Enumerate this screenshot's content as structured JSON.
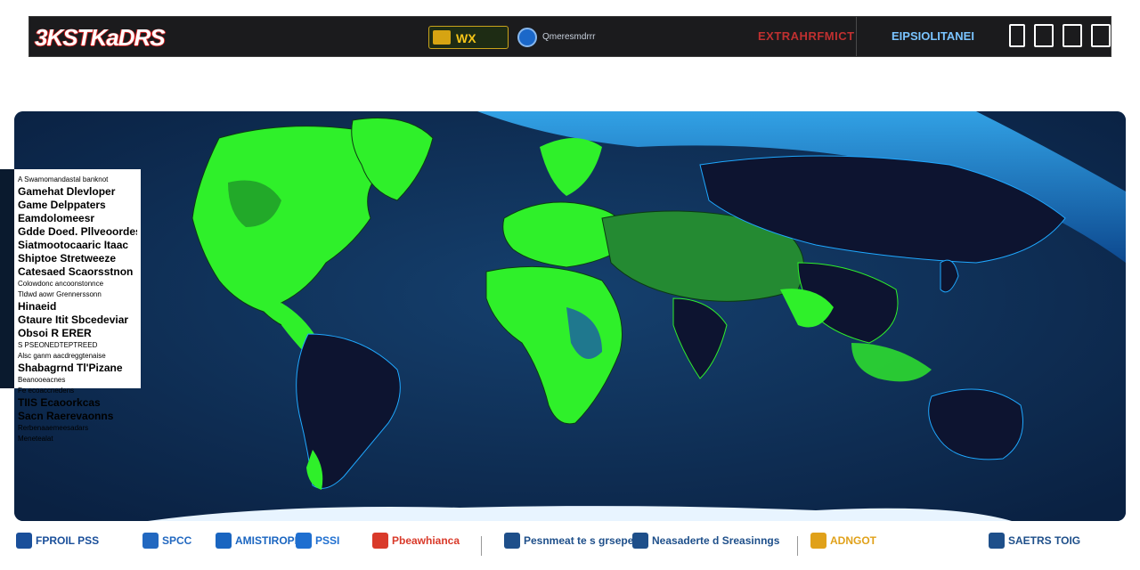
{
  "header": {
    "logo": "3KSTKaDRS",
    "badge1": "WX",
    "badge2": "Qmeresmdrrr",
    "center_text": "EXTRAHRFMICT",
    "right_text": "EIPSIOLITANEI"
  },
  "legend": {
    "rows": [
      {
        "text": "A Swamomandastal banknot",
        "style": "sm"
      },
      {
        "text": "Gamehat Dlevloper",
        "style": "b"
      },
      {
        "text": "Game Delppaters",
        "style": "b"
      },
      {
        "text": "Eamdolomeesr",
        "style": "b"
      },
      {
        "text": "Gdde Doed. Pllveoordes",
        "style": "b"
      },
      {
        "text": "Siatmootocaaric Itaac",
        "style": "b"
      },
      {
        "text": "Shiptoe Stretweeze",
        "style": "b"
      },
      {
        "text": "Catesaed Scaorsstnon",
        "style": "b"
      },
      {
        "text": "Colowdonc ancoonstonnce",
        "style": "sm"
      },
      {
        "text": "Tldwd aowr Grennerssonn",
        "style": "sm"
      },
      {
        "text": "Hinaeid",
        "style": "b"
      },
      {
        "text": "Gtaure Itit Sbcedeviar",
        "style": "b"
      },
      {
        "text": "Obsoi R ERER",
        "style": "b"
      },
      {
        "text": "S PSEONEDTEPTREED",
        "style": "sm"
      },
      {
        "text": "Alsc ganm aacdreggtenaise",
        "style": "sm"
      },
      {
        "text": "Shabagrnd Tl'Pizane",
        "style": "b"
      },
      {
        "text": "Beanooeacnes",
        "style": "sm"
      },
      {
        "text": "Fe ecoaccnedens",
        "style": "sm"
      },
      {
        "text": "TIIS Ecaoorkcas",
        "style": "b"
      },
      {
        "text": "Sacn Raerevaonns",
        "style": "b"
      },
      {
        "text": "Rerbenaaemeesadars",
        "style": "sm"
      },
      {
        "text": "Menetealat",
        "style": "sm"
      }
    ]
  },
  "footer": {
    "items": [
      {
        "label": "FPROIL PSS",
        "color": "#1a4f9a"
      },
      {
        "label": "SPCC",
        "color": "#2268c0"
      },
      {
        "label": "AMISTIROPP",
        "color": "#1a65c0"
      },
      {
        "label": "PSSI",
        "color": "#1f6fd0"
      },
      {
        "label": "Pbeawhianca",
        "color": "#d93a2a"
      },
      {
        "label": "Pesnmeat te s grsepes",
        "color": "#1e4f8a"
      },
      {
        "label": "Neasaderte d Sreasinngs",
        "color": "#1e4f8a"
      },
      {
        "label": "ADNGOT",
        "color": "#e0a11a"
      },
      {
        "label": "SAETRS TOIG",
        "color": "#1e4f8a"
      }
    ]
  },
  "colors": {
    "ocean": "#0d2a4d",
    "green_bright": "#2ff02a",
    "green_dark": "#248a32",
    "land_dark": "#0d1430",
    "ice": "#1f8fe0"
  }
}
